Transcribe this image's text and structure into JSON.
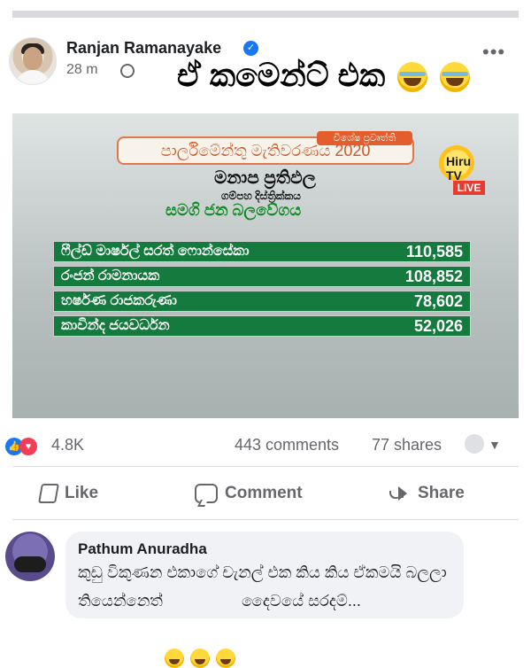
{
  "post": {
    "author": "Ranjan Ramanayake",
    "time": "28 m",
    "caption": "ඒ කමෙන්ට් එක"
  },
  "media": {
    "title": "පාර්ලිමේන්තු මැතිවරණය 2020",
    "badge": "විශේෂ ප්‍රවෘත්ති",
    "subtitle": "මනාප ප්‍රතිඵල",
    "district": "ගම්පහ දිස්ත්‍රික්කය",
    "party": "සමගි ජන බලවේගය",
    "channel": "Hiru TV",
    "live_label": "LIVE",
    "results": [
      {
        "name": "ෆීල්ඩ් මාර්ෂල් සරත් ෆොන්සේකා",
        "votes": "110,585"
      },
      {
        "name": "රංජන් රාමනායක",
        "votes": "108,852"
      },
      {
        "name": "හර්ෂණ රාජකරුණා",
        "votes": "78,602"
      },
      {
        "name": "කාවින්ද ජයවර්ධන",
        "votes": "52,026"
      }
    ]
  },
  "stats": {
    "reactions": "4.8K",
    "comments": "443 comments",
    "shares": "77 shares"
  },
  "actions": {
    "like": "Like",
    "comment": "Comment",
    "share": "Share"
  },
  "comment": {
    "name": "Pathum Anuradha",
    "line1": "කුඩු විකුණන එකාගේ චැනල් එක කිය කිය ඒකමයි බලලා",
    "line2_prefix": "තියෙන්නෙත්",
    "line2_suffix": "දෛවයේ සරදම්..."
  }
}
